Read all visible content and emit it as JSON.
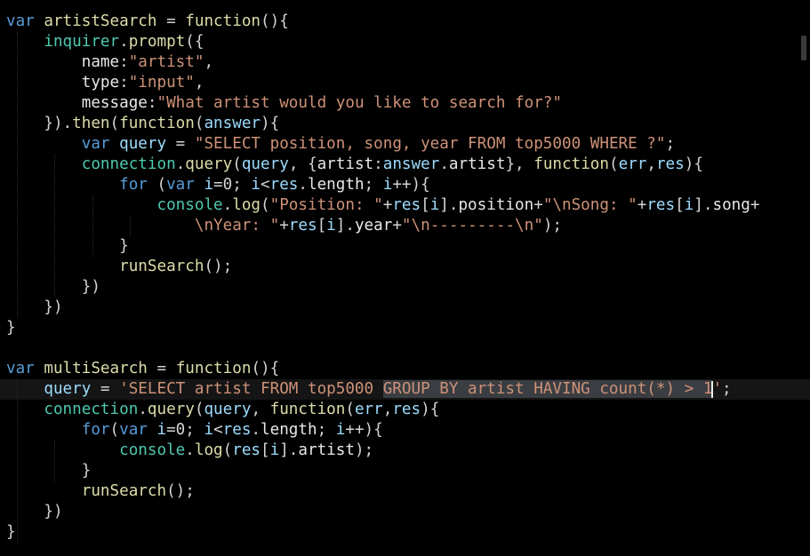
{
  "editor": {
    "theme_background": "#000000",
    "colors": {
      "keyword": "#569cd6",
      "function": "#dcdcaa",
      "variable": "#9cdcfe",
      "object": "#4ec9b0",
      "string": "#ce9178",
      "selection": "#3a3d41"
    },
    "lines": [
      {
        "tokens": [
          {
            "c": "kw",
            "t": "var"
          },
          {
            "c": "pl",
            "t": " "
          },
          {
            "c": "fn",
            "t": "artistSearch"
          },
          {
            "c": "op",
            "t": " = "
          },
          {
            "c": "fn",
            "t": "function"
          },
          {
            "c": "op",
            "t": "(){"
          }
        ]
      },
      {
        "tokens": [
          {
            "c": "pl",
            "t": "    "
          },
          {
            "c": "obj",
            "t": "inquirer"
          },
          {
            "c": "op",
            "t": "."
          },
          {
            "c": "fn",
            "t": "prompt"
          },
          {
            "c": "op",
            "t": "({"
          }
        ]
      },
      {
        "tokens": [
          {
            "c": "pl",
            "t": "        "
          },
          {
            "c": "pl",
            "t": "name"
          },
          {
            "c": "op",
            "t": ":"
          },
          {
            "c": "str",
            "t": "\"artist\""
          },
          {
            "c": "op",
            "t": ","
          }
        ]
      },
      {
        "tokens": [
          {
            "c": "pl",
            "t": "        "
          },
          {
            "c": "pl",
            "t": "type"
          },
          {
            "c": "op",
            "t": ":"
          },
          {
            "c": "str",
            "t": "\"input\""
          },
          {
            "c": "op",
            "t": ","
          }
        ]
      },
      {
        "tokens": [
          {
            "c": "pl",
            "t": "        "
          },
          {
            "c": "pl",
            "t": "message"
          },
          {
            "c": "op",
            "t": ":"
          },
          {
            "c": "str",
            "t": "\"What artist would you like to search for?\""
          }
        ]
      },
      {
        "tokens": [
          {
            "c": "pl",
            "t": "    "
          },
          {
            "c": "op",
            "t": "})."
          },
          {
            "c": "fn",
            "t": "then"
          },
          {
            "c": "op",
            "t": "("
          },
          {
            "c": "fn",
            "t": "function"
          },
          {
            "c": "op",
            "t": "("
          },
          {
            "c": "var",
            "t": "answer"
          },
          {
            "c": "op",
            "t": "){"
          }
        ]
      },
      {
        "tokens": [
          {
            "c": "pl",
            "t": "        "
          },
          {
            "c": "kw",
            "t": "var"
          },
          {
            "c": "pl",
            "t": " "
          },
          {
            "c": "var",
            "t": "query"
          },
          {
            "c": "op",
            "t": " = "
          },
          {
            "c": "str",
            "t": "\"SELECT position, song, year FROM top5000 WHERE ?\""
          },
          {
            "c": "op",
            "t": ";"
          }
        ]
      },
      {
        "tokens": [
          {
            "c": "pl",
            "t": "        "
          },
          {
            "c": "obj",
            "t": "connection"
          },
          {
            "c": "op",
            "t": "."
          },
          {
            "c": "fn",
            "t": "query"
          },
          {
            "c": "op",
            "t": "("
          },
          {
            "c": "var",
            "t": "query"
          },
          {
            "c": "op",
            "t": ", {"
          },
          {
            "c": "pl",
            "t": "artist"
          },
          {
            "c": "op",
            "t": ":"
          },
          {
            "c": "var",
            "t": "answer"
          },
          {
            "c": "op",
            "t": "."
          },
          {
            "c": "pl",
            "t": "artist"
          },
          {
            "c": "op",
            "t": "}, "
          },
          {
            "c": "fn",
            "t": "function"
          },
          {
            "c": "op",
            "t": "("
          },
          {
            "c": "var",
            "t": "err"
          },
          {
            "c": "op",
            "t": ","
          },
          {
            "c": "var",
            "t": "res"
          },
          {
            "c": "op",
            "t": "){"
          }
        ]
      },
      {
        "tokens": [
          {
            "c": "pl",
            "t": "            "
          },
          {
            "c": "kw",
            "t": "for"
          },
          {
            "c": "op",
            "t": " ("
          },
          {
            "c": "kw",
            "t": "var"
          },
          {
            "c": "pl",
            "t": " "
          },
          {
            "c": "var",
            "t": "i"
          },
          {
            "c": "op",
            "t": "=0; "
          },
          {
            "c": "var",
            "t": "i"
          },
          {
            "c": "op",
            "t": "<"
          },
          {
            "c": "var",
            "t": "res"
          },
          {
            "c": "op",
            "t": "."
          },
          {
            "c": "pl",
            "t": "length"
          },
          {
            "c": "op",
            "t": "; "
          },
          {
            "c": "var",
            "t": "i"
          },
          {
            "c": "op",
            "t": "++){"
          }
        ]
      },
      {
        "tokens": [
          {
            "c": "pl",
            "t": "                "
          },
          {
            "c": "obj",
            "t": "console"
          },
          {
            "c": "op",
            "t": "."
          },
          {
            "c": "fn",
            "t": "log"
          },
          {
            "c": "op",
            "t": "("
          },
          {
            "c": "str",
            "t": "\"Position: \""
          },
          {
            "c": "op",
            "t": "+"
          },
          {
            "c": "var",
            "t": "res"
          },
          {
            "c": "op",
            "t": "["
          },
          {
            "c": "var",
            "t": "i"
          },
          {
            "c": "op",
            "t": "]."
          },
          {
            "c": "pl",
            "t": "position"
          },
          {
            "c": "op",
            "t": "+"
          },
          {
            "c": "str",
            "t": "\"\\nSong: \""
          },
          {
            "c": "op",
            "t": "+"
          },
          {
            "c": "var",
            "t": "res"
          },
          {
            "c": "op",
            "t": "["
          },
          {
            "c": "var",
            "t": "i"
          },
          {
            "c": "op",
            "t": "]."
          },
          {
            "c": "pl",
            "t": "song"
          },
          {
            "c": "op",
            "t": "+"
          }
        ]
      },
      {
        "tokens": [
          {
            "c": "pl",
            "t": "                    "
          },
          {
            "c": "str",
            "t": "\\nYear: \""
          },
          {
            "c": "op",
            "t": "+"
          },
          {
            "c": "var",
            "t": "res"
          },
          {
            "c": "op",
            "t": "["
          },
          {
            "c": "var",
            "t": "i"
          },
          {
            "c": "op",
            "t": "]."
          },
          {
            "c": "pl",
            "t": "year"
          },
          {
            "c": "op",
            "t": "+"
          },
          {
            "c": "str",
            "t": "\"\\n---------\\n\""
          },
          {
            "c": "op",
            "t": ");"
          }
        ]
      },
      {
        "tokens": [
          {
            "c": "pl",
            "t": "            "
          },
          {
            "c": "op",
            "t": "}"
          }
        ]
      },
      {
        "tokens": [
          {
            "c": "pl",
            "t": "            "
          },
          {
            "c": "fn",
            "t": "runSearch"
          },
          {
            "c": "op",
            "t": "();"
          }
        ]
      },
      {
        "tokens": [
          {
            "c": "pl",
            "t": "        "
          },
          {
            "c": "op",
            "t": "})"
          }
        ]
      },
      {
        "tokens": [
          {
            "c": "pl",
            "t": "    "
          },
          {
            "c": "op",
            "t": "})"
          }
        ]
      },
      {
        "tokens": [
          {
            "c": "op",
            "t": "}"
          }
        ]
      },
      {
        "tokens": []
      },
      {
        "tokens": [
          {
            "c": "kw",
            "t": "var"
          },
          {
            "c": "pl",
            "t": " "
          },
          {
            "c": "fn",
            "t": "multiSearch"
          },
          {
            "c": "op",
            "t": " = "
          },
          {
            "c": "fn",
            "t": "function"
          },
          {
            "c": "op",
            "t": "(){"
          }
        ]
      },
      {
        "current": true,
        "tokens": [
          {
            "c": "pl",
            "t": "    "
          },
          {
            "c": "var",
            "t": "query"
          },
          {
            "c": "op",
            "t": " = "
          },
          {
            "c": "str",
            "t": "'SELECT artist FROM top5000 "
          },
          {
            "c": "str sel",
            "t": "GROUP BY artist HAVING count(*) > 1"
          },
          {
            "c": "cursor",
            "t": ""
          },
          {
            "c": "str",
            "t": "'"
          },
          {
            "c": "op",
            "t": ";"
          }
        ]
      },
      {
        "tokens": [
          {
            "c": "pl",
            "t": "    "
          },
          {
            "c": "obj",
            "t": "connection"
          },
          {
            "c": "op",
            "t": "."
          },
          {
            "c": "fn",
            "t": "query"
          },
          {
            "c": "op",
            "t": "("
          },
          {
            "c": "var",
            "t": "query"
          },
          {
            "c": "op",
            "t": ", "
          },
          {
            "c": "fn",
            "t": "function"
          },
          {
            "c": "op",
            "t": "("
          },
          {
            "c": "var",
            "t": "err"
          },
          {
            "c": "op",
            "t": ","
          },
          {
            "c": "var",
            "t": "res"
          },
          {
            "c": "op",
            "t": "){"
          }
        ]
      },
      {
        "tokens": [
          {
            "c": "pl",
            "t": "        "
          },
          {
            "c": "kw",
            "t": "for"
          },
          {
            "c": "op",
            "t": "("
          },
          {
            "c": "kw",
            "t": "var"
          },
          {
            "c": "pl",
            "t": " "
          },
          {
            "c": "var",
            "t": "i"
          },
          {
            "c": "op",
            "t": "=0; "
          },
          {
            "c": "var",
            "t": "i"
          },
          {
            "c": "op",
            "t": "<"
          },
          {
            "c": "var",
            "t": "res"
          },
          {
            "c": "op",
            "t": "."
          },
          {
            "c": "pl",
            "t": "length"
          },
          {
            "c": "op",
            "t": "; "
          },
          {
            "c": "var",
            "t": "i"
          },
          {
            "c": "op",
            "t": "++){"
          }
        ]
      },
      {
        "tokens": [
          {
            "c": "pl",
            "t": "            "
          },
          {
            "c": "obj",
            "t": "console"
          },
          {
            "c": "op",
            "t": "."
          },
          {
            "c": "fn",
            "t": "log"
          },
          {
            "c": "op",
            "t": "("
          },
          {
            "c": "var",
            "t": "res"
          },
          {
            "c": "op",
            "t": "["
          },
          {
            "c": "var",
            "t": "i"
          },
          {
            "c": "op",
            "t": "]."
          },
          {
            "c": "pl",
            "t": "artist"
          },
          {
            "c": "op",
            "t": ");"
          }
        ]
      },
      {
        "tokens": [
          {
            "c": "pl",
            "t": "        "
          },
          {
            "c": "op",
            "t": "}"
          }
        ]
      },
      {
        "tokens": [
          {
            "c": "pl",
            "t": "        "
          },
          {
            "c": "fn",
            "t": "runSearch"
          },
          {
            "c": "op",
            "t": "();"
          }
        ]
      },
      {
        "tokens": [
          {
            "c": "pl",
            "t": "    "
          },
          {
            "c": "op",
            "t": "})"
          }
        ]
      },
      {
        "tokens": [
          {
            "c": "op",
            "t": "}"
          }
        ]
      }
    ]
  }
}
